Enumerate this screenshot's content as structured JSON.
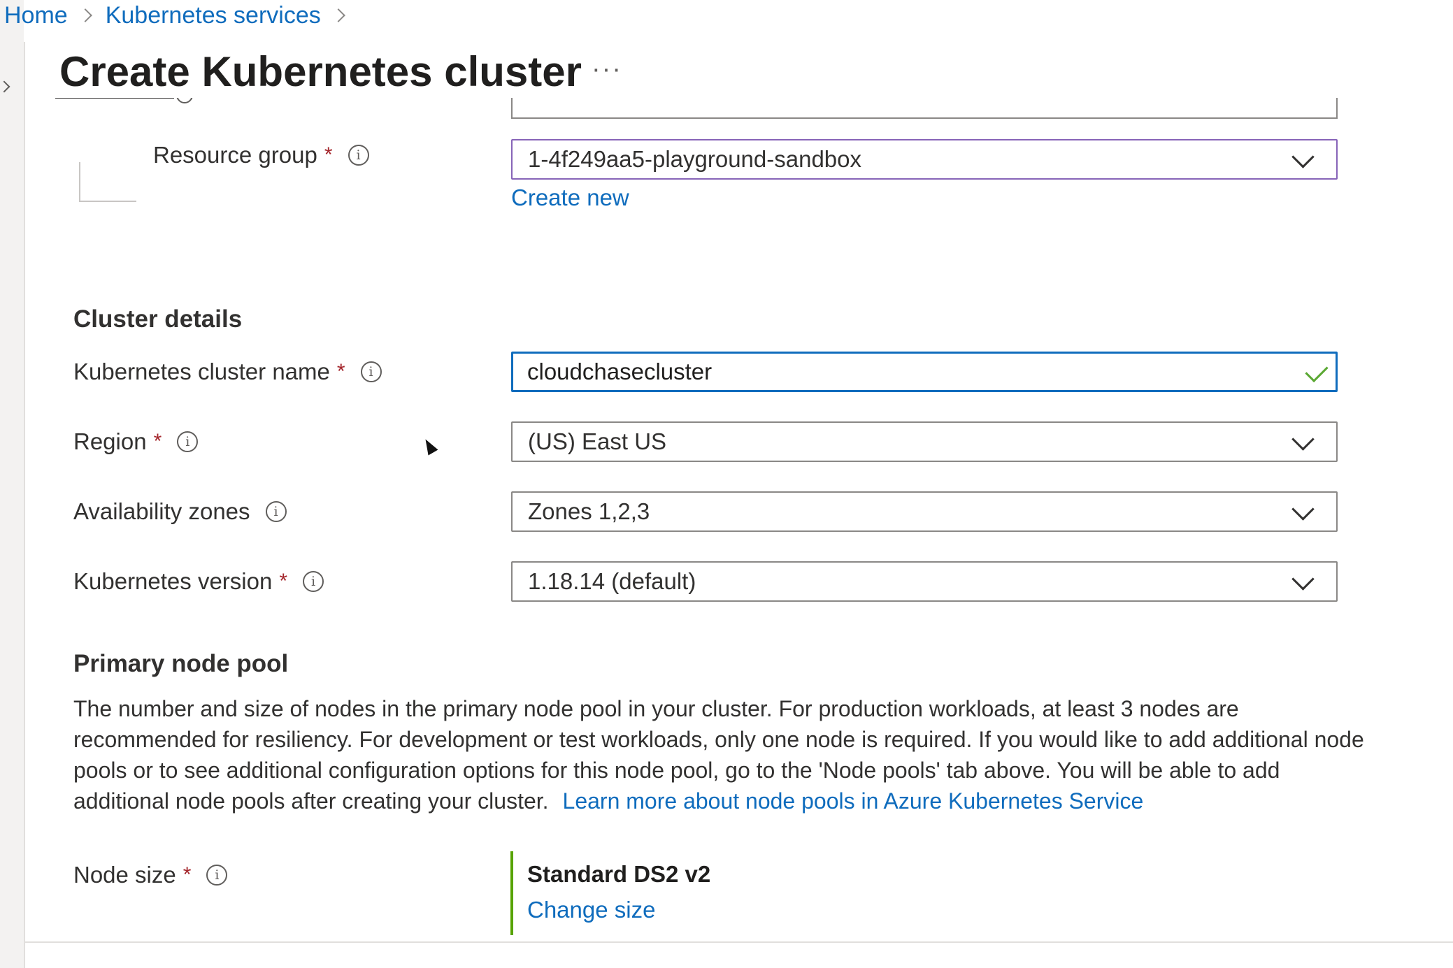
{
  "breadcrumb": {
    "home": "Home",
    "services": "Kubernetes services"
  },
  "page": {
    "title": "Create Kubernetes cluster",
    "more": "···"
  },
  "project": {
    "resource_group_label": "Resource group",
    "resource_group_value": "1-4f249aa5-playground-sandbox",
    "create_new": "Create new"
  },
  "cluster_details": {
    "title": "Cluster details",
    "name_label": "Kubernetes cluster name",
    "name_value": "cloudchasecluster",
    "region_label": "Region",
    "region_value": "(US) East US",
    "zones_label": "Availability zones",
    "zones_value": "Zones 1,2,3",
    "version_label": "Kubernetes version",
    "version_value": "1.18.14 (default)"
  },
  "node_pool": {
    "title": "Primary node pool",
    "description": "The number and size of nodes in the primary node pool in your cluster. For production workloads, at least 3 nodes are recommended for resiliency. For development or test workloads, only one node is required. If you would like to add additional node pools or to see additional configuration options for this node pool, go to the 'Node pools' tab above. You will be able to add additional node pools after creating your cluster.",
    "learn_more": "Learn more about node pools in Azure Kubernetes Service",
    "node_size_label": "Node size",
    "node_size_value": "Standard DS2 v2",
    "change_size": "Change size"
  },
  "common": {
    "required": "*",
    "info": "i"
  },
  "colors": {
    "link": "#0f6cbd",
    "required": "#a4262c",
    "valid_check": "#5aa832",
    "node_size_bar": "#57a300"
  }
}
